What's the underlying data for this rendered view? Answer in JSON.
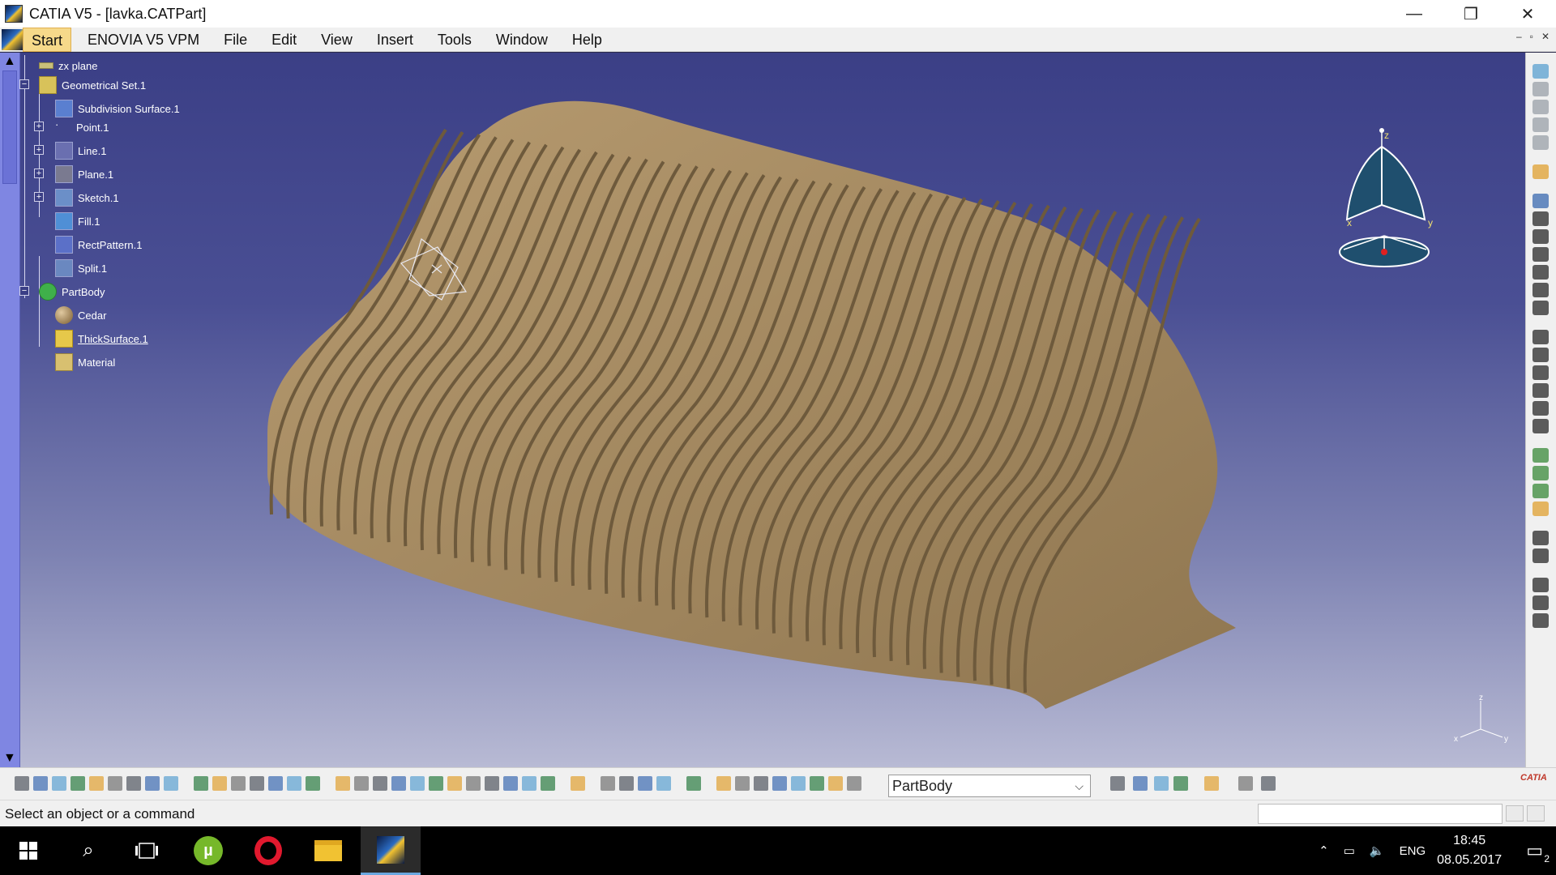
{
  "window": {
    "title": "CATIA V5 - [lavka.CATPart]",
    "minimize": "—",
    "restore": "❐",
    "close": "✕"
  },
  "menu": {
    "items": [
      "Start",
      "ENOVIA V5 VPM",
      "File",
      "Edit",
      "View",
      "Insert",
      "Tools",
      "Window",
      "Help"
    ],
    "active": "Start",
    "mdi": [
      "–",
      "▫",
      "✕"
    ]
  },
  "tree": {
    "nodes": [
      {
        "label": "zx plane",
        "icon": "plane-icon"
      },
      {
        "label": "Geometrical Set.1",
        "icon": "geometrical-set-icon"
      },
      {
        "label": "Subdivision Surface.1",
        "icon": "subdivision-surface-icon"
      },
      {
        "label": "Point.1",
        "icon": "point-icon"
      },
      {
        "label": "Line.1",
        "icon": "line-icon"
      },
      {
        "label": "Plane.1",
        "icon": "plane-icon"
      },
      {
        "label": "Sketch.1",
        "icon": "sketch-icon"
      },
      {
        "label": "Fill.1",
        "icon": "fill-icon"
      },
      {
        "label": "RectPattern.1",
        "icon": "rect-pattern-icon"
      },
      {
        "label": "Split.1",
        "icon": "split-icon"
      },
      {
        "label": "PartBody",
        "icon": "partbody-icon"
      },
      {
        "label": "Cedar",
        "icon": "material-sphere-icon"
      },
      {
        "label": "ThickSurface.1",
        "icon": "thick-surface-icon"
      },
      {
        "label": "Material",
        "icon": "material-icon"
      }
    ]
  },
  "compass": {
    "x": "x",
    "y": "y",
    "z": "z"
  },
  "axis": {
    "x": "x",
    "y": "y",
    "z": "z"
  },
  "toolbar": {
    "current_body": "PartBody",
    "brand": "CATIA"
  },
  "status": {
    "message": "Select an object or a command",
    "input_value": ""
  },
  "taskbar": {
    "language": "ENG",
    "time": "18:45",
    "date": "08.05.2017",
    "notifications": "2"
  },
  "colors": {
    "viewport_top": "#3b3f86",
    "viewport_bottom": "#b8bad4",
    "wood": "#a88c62",
    "wood_dark": "#6e5a3c",
    "menu_active": "#f6d98a"
  }
}
